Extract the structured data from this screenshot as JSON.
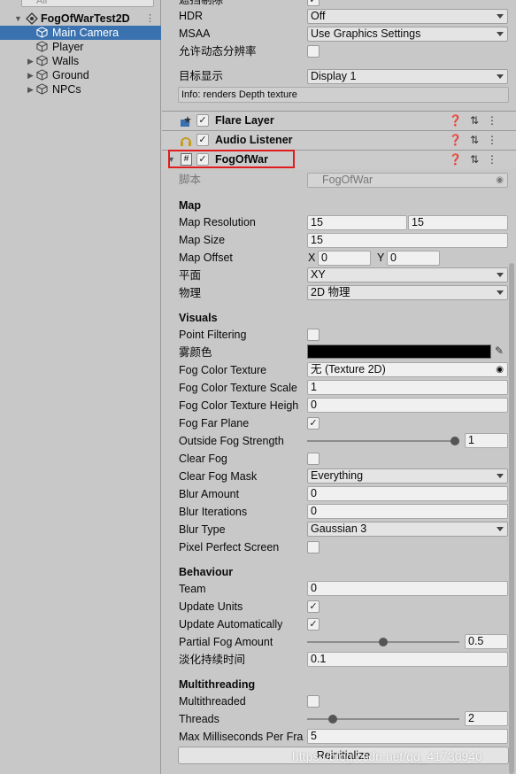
{
  "hierarchy": {
    "search_placeholder": "All",
    "root": "FogOfWarTest2D",
    "items": [
      "Main Camera",
      "Player",
      "Walls",
      "Ground",
      "NPCs"
    ]
  },
  "camera": {
    "cut_label": "遮挡剔除",
    "hdr_label": "HDR",
    "hdr_value": "Off",
    "msaa_label": "MSAA",
    "msaa_value": "Use Graphics Settings",
    "dynres_label": "允许动态分辨率",
    "target_label": "目标显示",
    "target_value": "Display 1",
    "info": "Info: renders Depth texture"
  },
  "components": {
    "flare": "Flare Layer",
    "audio": "Audio Listener",
    "fog": "FogOfWar"
  },
  "fog": {
    "script_label": "脚本",
    "script_value": "FogOfWar",
    "map_section": "Map",
    "map_resolution_label": "Map Resolution",
    "map_resolution_x": "15",
    "map_resolution_y": "15",
    "map_size_label": "Map Size",
    "map_size_value": "15",
    "map_offset_label": "Map Offset",
    "map_offset_x_label": "X",
    "map_offset_x": "0",
    "map_offset_y_label": "Y",
    "map_offset_y": "0",
    "plane_label": "平面",
    "plane_value": "XY",
    "physics_label": "物理",
    "physics_value": "2D 物理",
    "visuals_section": "Visuals",
    "point_filtering_label": "Point Filtering",
    "fog_color_label": "雾颜色",
    "fog_color": "#000000",
    "fog_color_texture_label": "Fog Color Texture",
    "fog_color_texture_value": "无 (Texture 2D)",
    "fog_color_texture_scale_label": "Fog Color Texture Scale",
    "fog_color_texture_scale_value": "1",
    "fog_color_texture_height_label": "Fog Color Texture Heigh",
    "fog_color_texture_height_value": "0",
    "fog_far_plane_label": "Fog Far Plane",
    "outside_fog_strength_label": "Outside Fog Strength",
    "outside_fog_strength_value": "1",
    "clear_fog_label": "Clear Fog",
    "clear_fog_mask_label": "Clear Fog Mask",
    "clear_fog_mask_value": "Everything",
    "blur_amount_label": "Blur Amount",
    "blur_amount_value": "0",
    "blur_iterations_label": "Blur Iterations",
    "blur_iterations_value": "0",
    "blur_type_label": "Blur Type",
    "blur_type_value": "Gaussian 3",
    "pixel_perfect_label": "Pixel Perfect Screen",
    "behaviour_section": "Behaviour",
    "team_label": "Team",
    "team_value": "0",
    "update_units_label": "Update Units",
    "update_auto_label": "Update Automatically",
    "partial_fog_label": "Partial Fog Amount",
    "partial_fog_value": "0.5",
    "fade_label": "淡化持续时间",
    "fade_value": "0.1",
    "multithreading_section": "Multithreading",
    "multithreaded_label": "Multithreaded",
    "threads_label": "Threads",
    "threads_value": "2",
    "max_ms_label": "Max Milliseconds Per Fra",
    "max_ms_value": "5",
    "reinit_label": "Reinitialize"
  },
  "state": {
    "dynres_checked": false,
    "fog_checked": true,
    "flare_checked": true,
    "audio_checked": true,
    "point_filtering": false,
    "fog_far_plane": true,
    "clear_fog": false,
    "pixel_perfect": false,
    "update_units": true,
    "update_auto": true,
    "multithreaded": false,
    "outside_fog_strength": 1,
    "partial_fog_amount": 0.5,
    "threads": 2
  },
  "watermark": "https://blog.csdn.net/qq_41730940",
  "colors": {
    "selection": "#3a72b0",
    "highlight_box": "#e21c1c"
  }
}
